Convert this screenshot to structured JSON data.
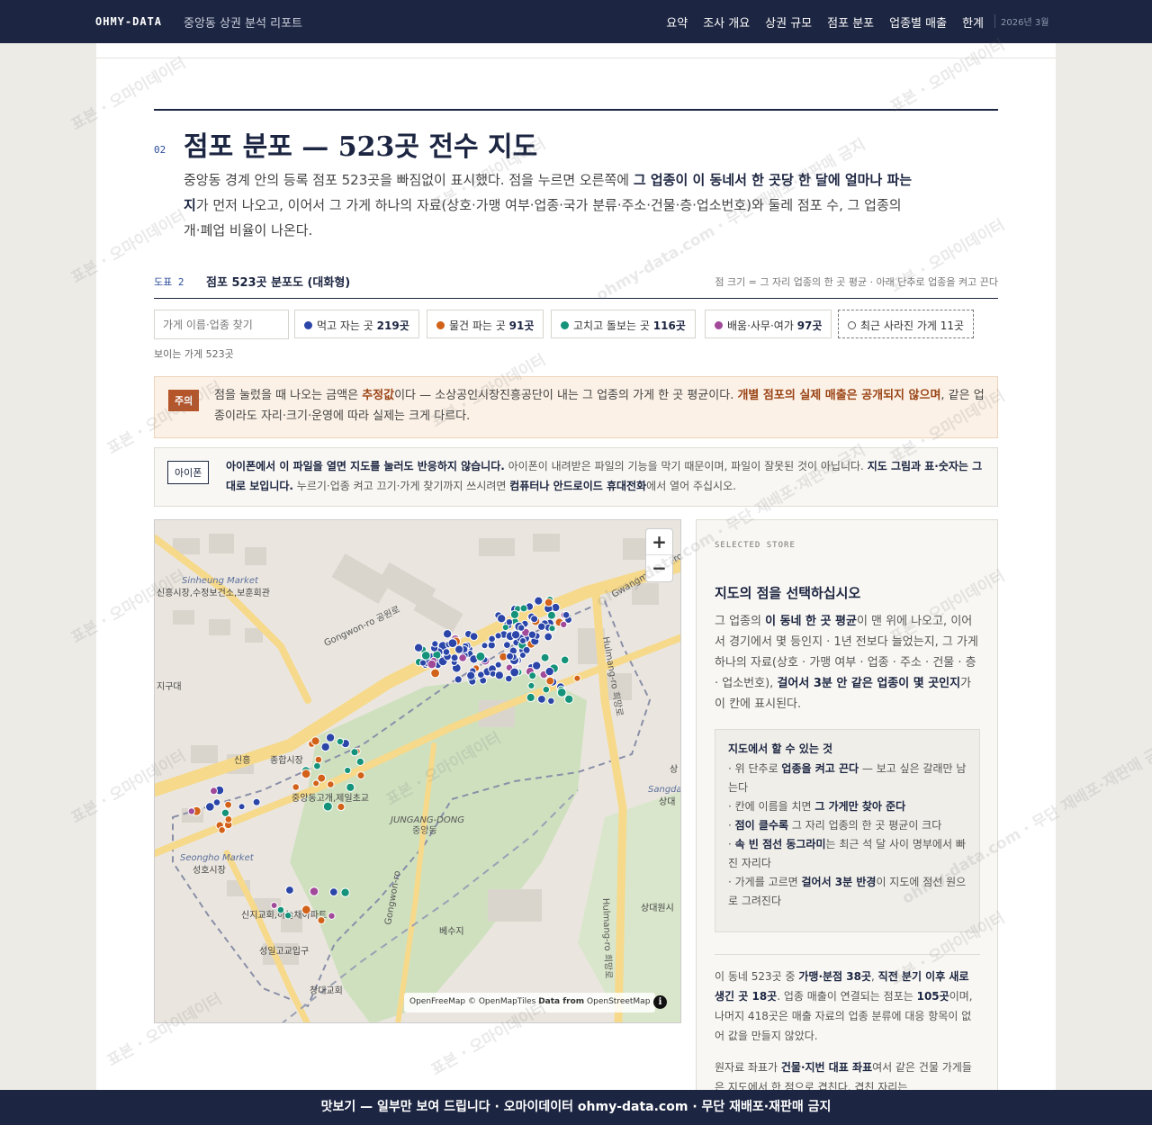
{
  "header": {
    "brand": "OHMY-DATA",
    "subtitle": "중앙동 상권 분석 리포트",
    "nav": [
      "요약",
      "조사 개요",
      "상권 규모",
      "점포 분포",
      "업종별 매출",
      "한계"
    ],
    "date": "2026년 3월"
  },
  "section": {
    "number": "02",
    "title": "점포 분포 — 523곳 전수 지도",
    "lead_1": "중앙동 경계 안의 등록 점포 523곳을 빠짐없이 표시했다. 점을 누르면 오른쪽에 ",
    "lead_bold": "그 업종이 이 동네서 한 곳당 한 달에 얼마나 파는지",
    "lead_2": "가 먼저 나오고, 이어서 그 가게 하나의 자료(상호·가맹 여부·업종·국가 분류·주소·건물·층·업소번호)와 둘레 점포 수, 그 업종의 개·폐업 비율이 나온다."
  },
  "figure": {
    "number": "도표 2",
    "title": "점포 523곳 분포도 (대화형)",
    "note": "점 크기 = 그 자리 업종의 한 곳 평균 · 아래 단추로 업종을 켜고 끈다"
  },
  "filters": {
    "search_placeholder": "가게 이름·업종 찾기",
    "chips": [
      {
        "label": "먹고 자는 곳",
        "count": "219곳",
        "color": "#2b46a8"
      },
      {
        "label": "물건 파는 곳",
        "count": "91곳",
        "color": "#d2621a"
      },
      {
        "label": "고치고 돌보는 곳",
        "count": "116곳",
        "color": "#14937a"
      },
      {
        "label": "배움·사무·여가",
        "count": "97곳",
        "color": "#a04a99"
      }
    ],
    "closed_label": "최근 사라진 가게 11곳",
    "visible_text": "보이는 가게 523곳"
  },
  "warning": {
    "tag": "주의",
    "t1": "점을 눌렀을 때 나오는 금액은 ",
    "b1": "추정값",
    "t2": "이다 — 소상공인시장진흥공단이 내는 그 업종의 가게 한 곳 평균이다. ",
    "b2": "개별 점포의 실제 매출은 공개되지 않으며",
    "t3": ", 같은 업종이라도 자리·크기·운영에 따라 실제는 크게 다르다."
  },
  "ios": {
    "tag": "아이폰",
    "b1": "아이폰에서 이 파일을 열면 지도를 눌러도 반응하지 않습니다.",
    "t1": " 아이폰이 내려받은 파일의 기능을 막기 때문이며, 파일이 잘못된 것이 아닙니다. ",
    "b2": "지도 그림과 표·숫자는 그대로 보입니다.",
    "t2": " 누르기·업종 켜고 끄기·가게 찾기까지 쓰시려면 ",
    "b3": "컴퓨터나 안드로이드 휴대전화",
    "t3": "에서 열어 주십시오."
  },
  "map": {
    "zoom_in": "+",
    "zoom_out": "−",
    "labels": [
      {
        "text": "Sinheung Market",
        "cls": "en"
      },
      {
        "text": "신흥시장,수정보건소,보훈회관",
        "cls": "ko"
      },
      {
        "text": "Gongwon-ro 공원로",
        "cls": "road"
      },
      {
        "text": "지구대",
        "cls": "ko"
      },
      {
        "text": "신흥",
        "cls": "ko"
      },
      {
        "text": "종합시장",
        "cls": "ko"
      },
      {
        "text": "중앙동고개,제일초교",
        "cls": "ko"
      },
      {
        "text": "JUNGANG-DONG",
        "cls": "en"
      },
      {
        "text": "중앙동",
        "cls": "ko"
      },
      {
        "text": "Seongho Market",
        "cls": "en"
      },
      {
        "text": "성호시장",
        "cls": "ko"
      },
      {
        "text": "신지교회,하늘채아파트",
        "cls": "ko"
      },
      {
        "text": "성일고교입구",
        "cls": "ko"
      },
      {
        "text": "베수지",
        "cls": "ko"
      },
      {
        "text": "창대교회",
        "cls": "ko"
      },
      {
        "text": "Gwangmyeong-ro",
        "cls": "road"
      },
      {
        "text": "Hulmang-ro 희망로",
        "cls": "road"
      },
      {
        "text": "Hulmang-ro 희망로",
        "cls": "road"
      },
      {
        "text": "Gongwon-ro",
        "cls": "road"
      },
      {
        "text": "상대원시",
        "cls": "ko"
      },
      {
        "text": "Sangdae",
        "cls": "en"
      },
      {
        "text": "상대",
        "cls": "ko"
      },
      {
        "text": "상",
        "cls": "ko"
      }
    ],
    "attribution_1": "OpenFreeMap © OpenMapTiles ",
    "attribution_2": "Data from",
    "attribution_3": " OpenStreetMap",
    "info": "i"
  },
  "panel": {
    "kicker": "SELECTED STORE",
    "title": "지도의 점을 선택하십시오",
    "d1": "그 업종의 ",
    "db1": "이 동네 한 곳 평균",
    "d2": "이 맨 위에 나오고, 이어서 경기에서 몇 등인지 · 1년 전보다 늘었는지, 그 가게 하나의 자료(상호 · 가맹 여부 · 업종 · 주소 · 건물 · 층 · 업소번호), ",
    "db2": "걸어서 3분 안 같은 업종이 몇 곳인지",
    "d3": "가 이 칸에 표시된다.",
    "box_title": "지도에서 할 수 있는 것",
    "box_1a": "· 위 단추로 ",
    "box_1b": "업종을 켜고 끈다",
    "box_1c": " — 보고 싶은 갈래만 남는다",
    "box_2a": "· 칸에 이름을 치면 ",
    "box_2b": "그 가게만 찾아 준다",
    "box_3a": "· ",
    "box_3b": "점이 클수록",
    "box_3c": " 그 자리 업종의 한 곳 평균이 크다",
    "box_4a": "· ",
    "box_4b": "속 빈 점선 동그라미",
    "box_4c": "는 최근 석 달 사이 명부에서 빠진 자리다",
    "box_5a": "· 가게를 고르면 ",
    "box_5b": "걸어서 3분 반경",
    "box_5c": "이 지도에 점선 원으로 그려진다",
    "s1": "이 동네 523곳 중 ",
    "sb1": "가맹·분점 38곳",
    "s2": ", ",
    "sb2": "직전 분기 이후 새로 생긴 곳 18곳",
    "s3": ". 업종 매출이 연결되는 점포는 ",
    "sb3": "105곳",
    "s4": "이며, 나머지 418곳은 매출 자료의 업종 분류에 대응 항목이 없어 값을 만들지 않았다.",
    "r1": "원자료 좌표가 ",
    "rb1": "건물·지번 대표 좌표",
    "r2": "여서 같은 건물 가게들은 지도에서 한 점으로 겹친다. 겹친 자리는"
  },
  "footer": {
    "banner": "맛보기 — 일부만 보여 드립니다 · 오마이데이터 ohmy-data.com · 무단 재배포·재판매 금지"
  },
  "watermark": {
    "text_1": "표본 · 오마이데이터",
    "text_2": "ohmy-data.com · 무단 재배포·재판매 금지"
  },
  "colors": {
    "navy": "#1c2541",
    "food": "#2b46a8",
    "retail": "#d2621a",
    "service": "#14937a",
    "edu": "#a04a99",
    "road_major": "#f6d98a",
    "park": "#cfe0bf"
  }
}
